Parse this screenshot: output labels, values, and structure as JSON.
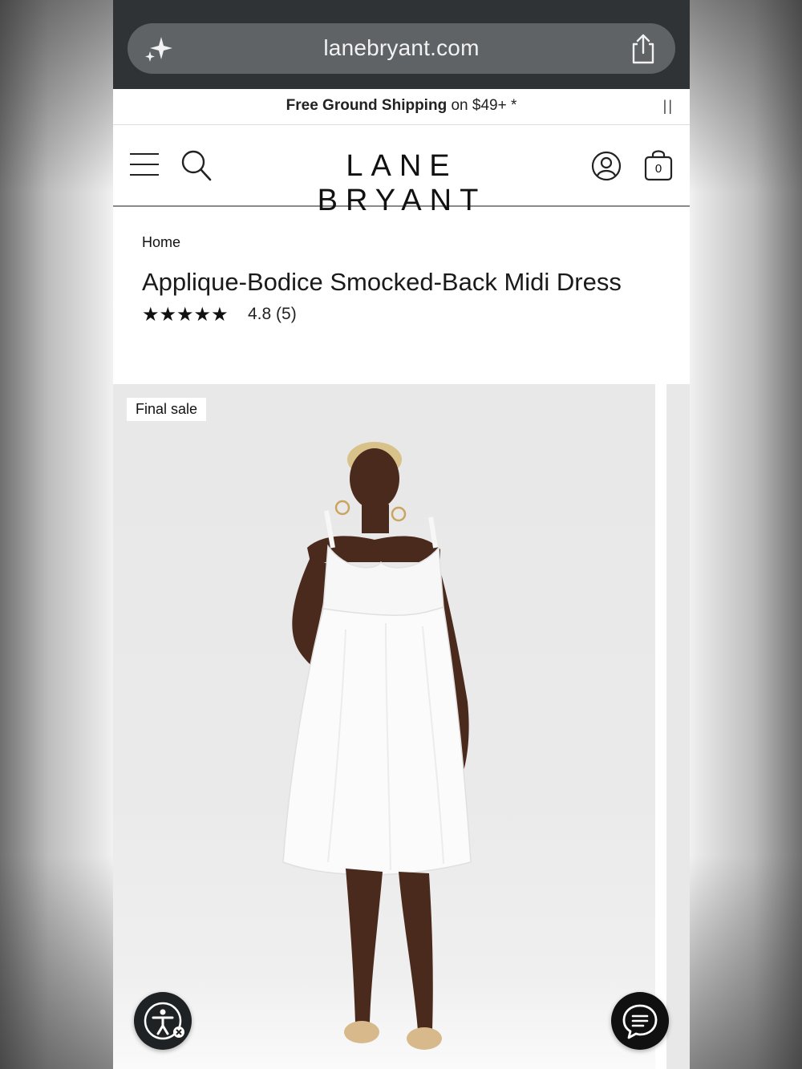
{
  "browser": {
    "url": "lanebryant.com"
  },
  "promo": {
    "bold_text": "Free Ground Shipping",
    "rest_text": " on $49+  *",
    "pause_label": "||"
  },
  "header": {
    "logo": "LANE BRYANT",
    "bag_count": "0"
  },
  "product": {
    "breadcrumb": "Home",
    "title": "Applique-Bodice Smocked-Back Midi Dress",
    "stars": "★★★★★",
    "rating_text": "4.8 (5)",
    "badge": "Final sale"
  },
  "icons": {
    "sparkle": "sparkle-icon",
    "share": "share-icon",
    "menu": "hamburger-menu-icon",
    "search": "search-icon",
    "account": "account-icon",
    "bag": "shopping-bag-icon",
    "accessibility": "accessibility-icon",
    "chat": "chat-icon"
  }
}
